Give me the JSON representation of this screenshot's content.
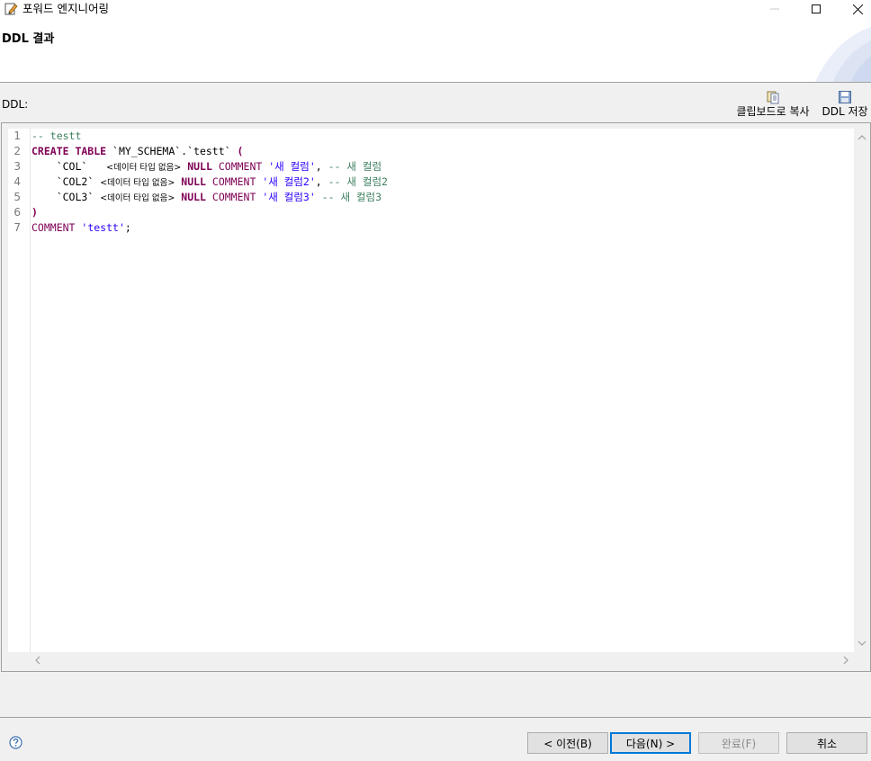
{
  "window": {
    "title": "포워드 엔지니어링",
    "min_symbol": "—",
    "max_symbol": "☐",
    "close_symbol": "✕"
  },
  "banner": {
    "title": "DDL 결과"
  },
  "toolbar": {
    "ddl_label": "DDL:",
    "copy_label": "클립보드로 복사",
    "copy_icon": "clipboard-icon",
    "save_label": "DDL 저장",
    "save_icon": "floppy-disk-icon"
  },
  "editor": {
    "line_numbers": [
      "1",
      "2",
      "3",
      "4",
      "5",
      "6",
      "7"
    ],
    "lines": [
      {
        "comment": "-- testt"
      },
      {
        "kw1": "CREATE TABLE",
        "text": " `MY_SCHEMA`.`testt` ",
        "paren": "("
      },
      {
        "indent": "    ",
        "col": "`COL`",
        "gap": "  ",
        "datatype": "<데이터 타입 없음>",
        "null": "NULL",
        "comment_kw": "COMMENT",
        "str": "'새 컬럼'",
        "sep": ",",
        "comment": " -- 새 컬럼"
      },
      {
        "indent": "    ",
        "col": "`COL2`",
        "gap": " ",
        "datatype": "<데이터 타입 없음>",
        "null": "NULL",
        "comment_kw": "COMMENT",
        "str": "'새 컬럼2'",
        "sep": ",",
        "comment": " -- 새 컬럼2"
      },
      {
        "indent": "    ",
        "col": "`COL3`",
        "gap": " ",
        "datatype": "<데이터 타입 없음>",
        "null": "NULL",
        "comment_kw": "COMMENT",
        "str": "'새 컬럼3'",
        "sep": "",
        "comment": " -- 새 컬럼3"
      },
      {
        "paren": ")"
      },
      {
        "comment_kw": "COMMENT",
        "str": "'testt'",
        "end": ";"
      }
    ]
  },
  "footer": {
    "back_label": "< 이전(B)",
    "next_label": "다음(N) >",
    "finish_label": "완료(F)",
    "cancel_label": "취소",
    "help_icon": "help-icon"
  },
  "colors": {
    "keyword": "#7f0055",
    "string": "#2a00ff",
    "comment": "#3f7f5f",
    "focus": "#0078d7"
  }
}
